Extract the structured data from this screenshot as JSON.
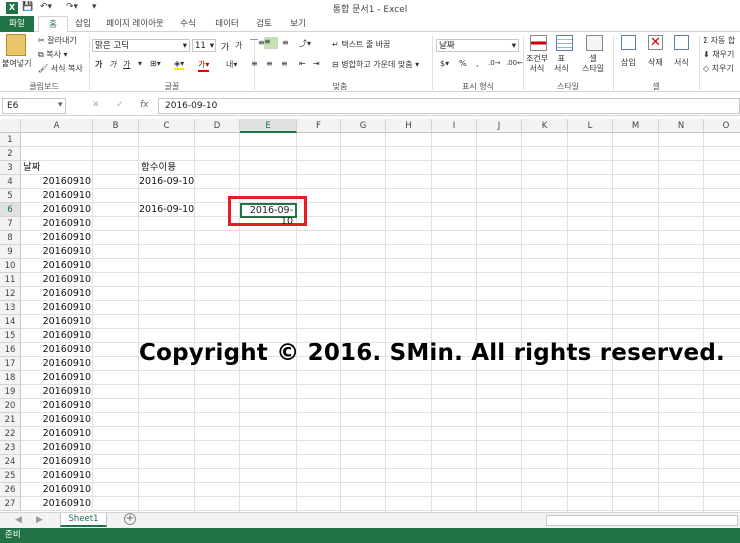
{
  "window": {
    "title": "통합 문서1 - Excel",
    "app_icon": "X"
  },
  "tabs": [
    "파일",
    "홈",
    "삽입",
    "페이지 레이아웃",
    "수식",
    "데이터",
    "검토",
    "보기"
  ],
  "ribbon": {
    "paste": "붙여넣기",
    "cut": "잘라내기",
    "copy": "복사",
    "format_painter": "서식 복사",
    "clipboard": "클립보드",
    "font_name": "맑은 고딕",
    "font_size": "11",
    "font_group": "글꼴",
    "wrap_text": "텍스트 줄 바꿈",
    "merge_center": "병합하고 가운데 맞춤",
    "alignment": "맞춤",
    "number_format": "날짜",
    "number_group": "표시 형식",
    "cond_format": "조건부\n서식",
    "table_format": "표\n서식",
    "cell_style": "셀\n스타일",
    "styles": "스타일",
    "insert": "삽입",
    "delete": "삭제",
    "format": "서식",
    "cells": "셀",
    "autosum": "자동 합",
    "fill": "채우기",
    "clear": "지우기",
    "bold": "가",
    "italic": "가",
    "underline": "가",
    "currency": "$",
    "percent": "%",
    "comma": ","
  },
  "formula_bar": {
    "name_box": "E6",
    "fx": "fx",
    "formula": "2016-09-10"
  },
  "columns": [
    "A",
    "B",
    "C",
    "D",
    "E",
    "F",
    "G",
    "H",
    "I",
    "J",
    "K",
    "L",
    "M",
    "N",
    "O"
  ],
  "rows": [
    "1",
    "2",
    "3",
    "4",
    "5",
    "6",
    "7",
    "8",
    "9",
    "10",
    "11",
    "12",
    "13",
    "14",
    "15",
    "16",
    "17",
    "18",
    "19",
    "20",
    "21",
    "22",
    "23",
    "24",
    "25",
    "26",
    "27"
  ],
  "cells": {
    "A3": "날짜",
    "C3": "함수이용",
    "A_values": [
      "20160910",
      "20160910",
      "20160910",
      "20160910",
      "20160910",
      "20160910",
      "20160910",
      "20160910",
      "20160910",
      "20160910",
      "20160910",
      "20160910",
      "20160910",
      "20160910",
      "20160910",
      "20160910",
      "20160910",
      "20160910",
      "20160910",
      "20160910",
      "20160910",
      "20160910",
      "20160910",
      "20160910"
    ],
    "C4": "2016-09-10",
    "C6": "2016-09-10",
    "E6": "2016-09-10"
  },
  "overlay_text": "Copyright © 2016. SMin. All rights reserved.",
  "sheet": {
    "name": "Sheet1",
    "add": "+"
  },
  "status": "준비"
}
